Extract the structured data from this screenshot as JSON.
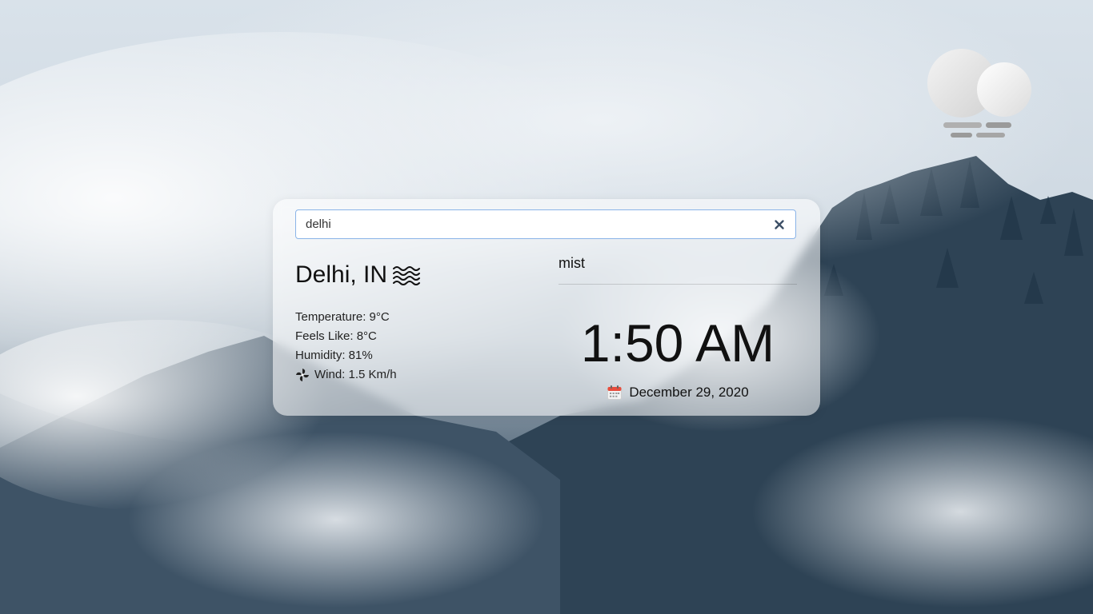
{
  "search": {
    "value": "delhi",
    "clear_icon": "close-icon"
  },
  "weather": {
    "city": "Delhi, IN",
    "condition_icon": "haze-icon",
    "description": "mist",
    "temperature_label": "Temperature: 9°C",
    "feels_like_label": "Feels Like: 8°C",
    "humidity_label": "Humidity: 81%",
    "wind_label": "Wind: 1.5 Km/h",
    "wind_icon": "fan-icon"
  },
  "clock": {
    "time": "1:50 AM",
    "date": "December 29, 2020",
    "date_icon": "calendar-icon"
  },
  "decor": {
    "corner_icon": "cloud-fog-icon"
  }
}
